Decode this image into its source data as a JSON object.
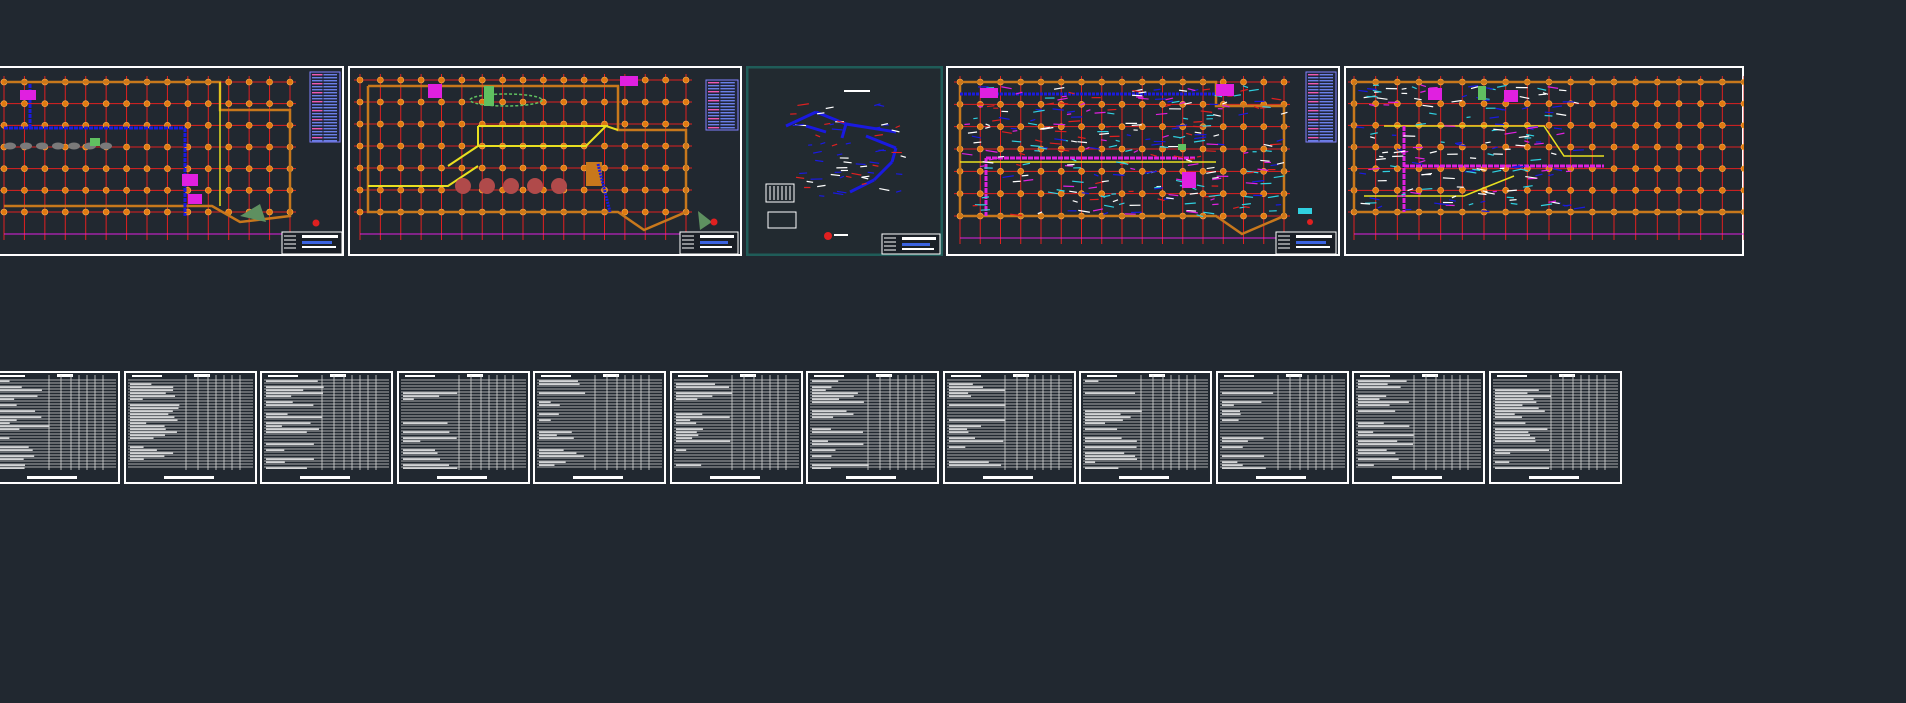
{
  "viewport": {
    "background": "#212830"
  },
  "colors": {
    "sheet_border": "#ffffff",
    "selected_border": "#1f5c58",
    "grid_red": "#e02020",
    "wall_orange": "#c8781c",
    "column_orange": "#e07a10",
    "yellow": "#e8e020",
    "blue": "#1a1ae0",
    "magenta": "#e020e0",
    "green": "#60c060",
    "cyan": "#30d0e0",
    "legend_blue": "#6b7fe8",
    "legend_pink": "#f05ab4"
  },
  "plan_sheets": [
    {
      "kind": "floor-plan",
      "variant": "plumbing-blue"
    },
    {
      "kind": "floor-plan",
      "variant": "ground-landscape"
    },
    {
      "kind": "axonometric",
      "variant": "riser-diagram",
      "selected": true
    },
    {
      "kind": "floor-plan",
      "variant": "sprinkler-dense"
    },
    {
      "kind": "floor-plan",
      "variant": "sprinkler-partial"
    }
  ],
  "spec_sheets_count": 12
}
